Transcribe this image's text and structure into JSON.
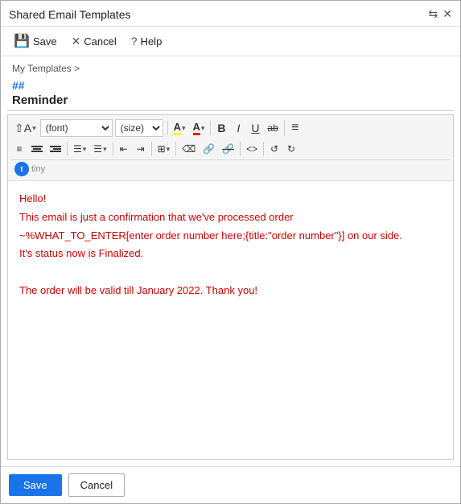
{
  "window": {
    "title": "Shared Email Templates",
    "pin_icon": "📌",
    "close_icon": "✕"
  },
  "toolbar": {
    "save_label": "Save",
    "cancel_label": "Cancel",
    "help_label": "Help"
  },
  "breadcrumb": {
    "text": "My Templates",
    "separator": ">"
  },
  "template": {
    "hash": "##",
    "title": "Reminder"
  },
  "editor": {
    "font_placeholder": "(font)",
    "size_placeholder": "(size)",
    "line1": "Hello!",
    "line2": "This email is just a confirmation that we've processed order",
    "line3_part1": "~%WHAT_TO_ENTER[enter order number here;{title:\"order number\"}]",
    "line3_part2": " on our side.",
    "line4": "It's status now is Finalized.",
    "line5": "",
    "line6": "The order will be valid till January 2022. Thank you!"
  },
  "footer": {
    "save_label": "Save",
    "cancel_label": "Cancel"
  },
  "icons": {
    "format_text": "A",
    "highlight": "A",
    "font_color": "A",
    "bold": "B",
    "italic": "I",
    "underline": "U",
    "strikethrough": "ab",
    "more_format": "≡",
    "align_left": "≡",
    "align_center": "≡",
    "align_right": "≡",
    "bullet_list": "☰",
    "numbered_list": "☰",
    "indent": "⇥",
    "outdent": "⇤",
    "table": "⊞",
    "eraser": "✗",
    "link": "🔗",
    "unlink": "⊘",
    "code": "<>",
    "undo": "↺",
    "redo": "↻"
  }
}
